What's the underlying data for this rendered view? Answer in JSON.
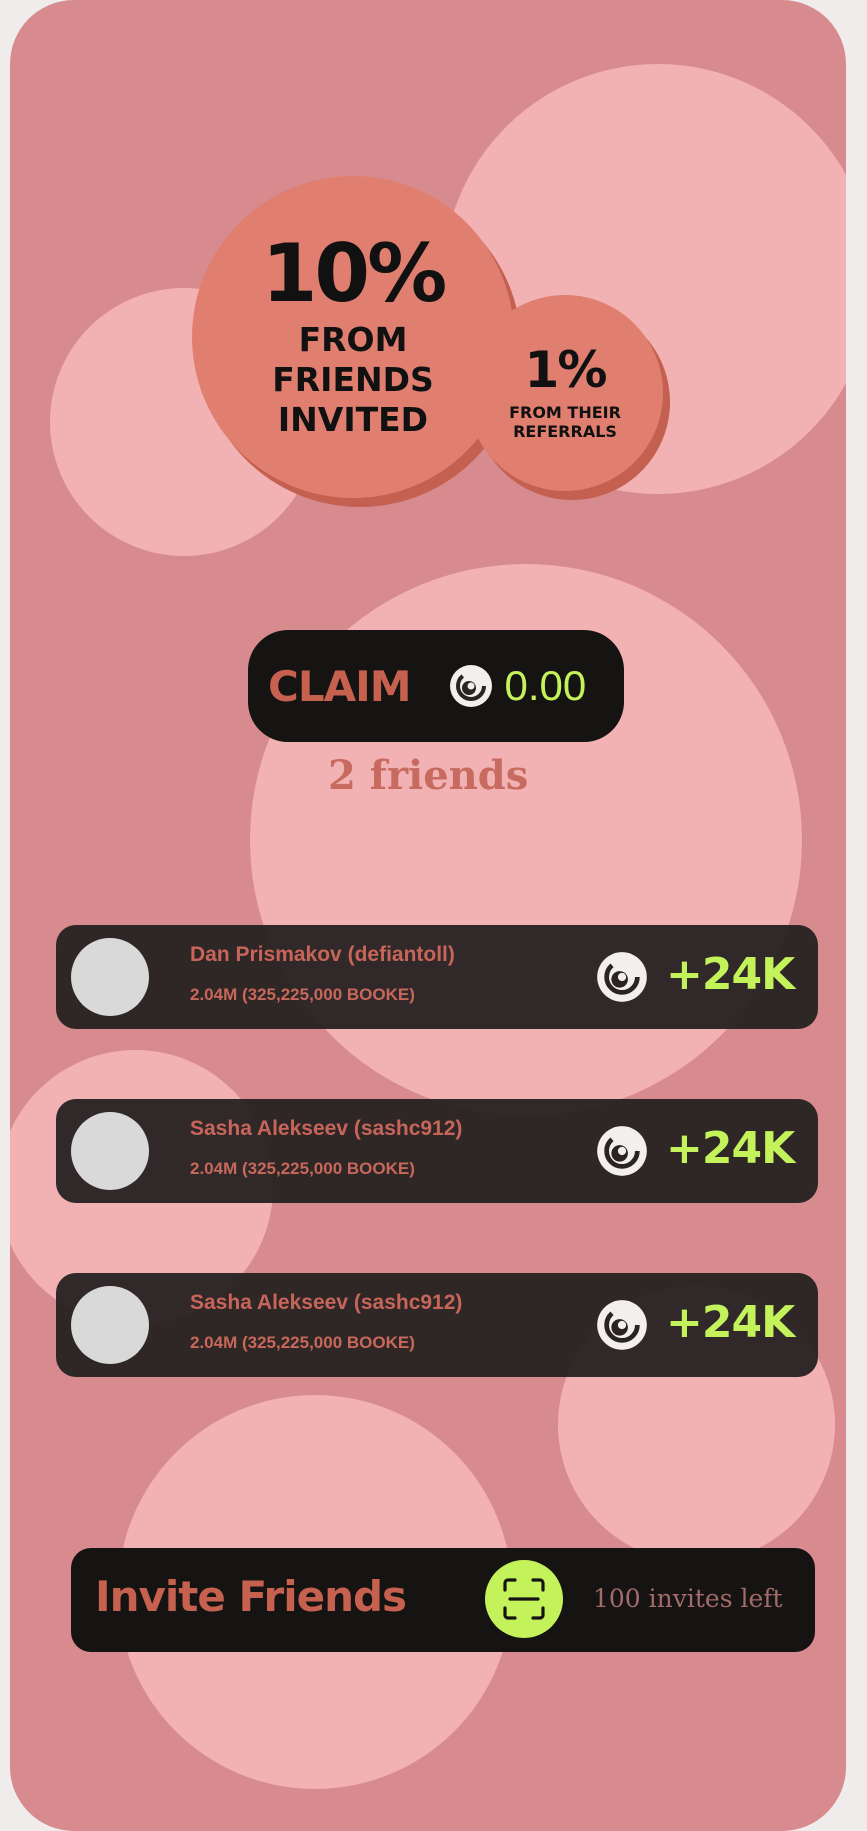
{
  "hero": {
    "main_percent": "10%",
    "main_label_line1": "from",
    "main_label_line2": "friends",
    "main_label_line3": "invited",
    "side_percent": "1%",
    "side_label_line1": "FROM THEIR",
    "side_label_line2": "REFERRALS"
  },
  "claim": {
    "label": "CLAIM",
    "value": "0.00",
    "coin_icon": "booke-coin-icon"
  },
  "friends_count": "2 friends",
  "friends": [
    {
      "name": "Dan Prismakov (defiantoll)",
      "balance": "2.04M (325,225,000 BOOKE)",
      "reward": "+24K"
    },
    {
      "name": "Sasha Alekseev (sashc912)",
      "balance": "2.04M (325,225,000 BOOKE)",
      "reward": "+24K"
    },
    {
      "name": "Sasha Alekseev (sashc912)",
      "balance": "2.04M (325,225,000 BOOKE)",
      "reward": "+24K"
    }
  ],
  "invite": {
    "label": "Invite Friends",
    "invites_left": "100 invites left",
    "scan_icon": "qr-scan-icon"
  },
  "colors": {
    "background": "#d78b8e",
    "blob": "#f2b1b2",
    "coin": "#e07f70",
    "accent": "#c3f25a",
    "dark": "#161313",
    "brand_text": "#c6614f"
  }
}
